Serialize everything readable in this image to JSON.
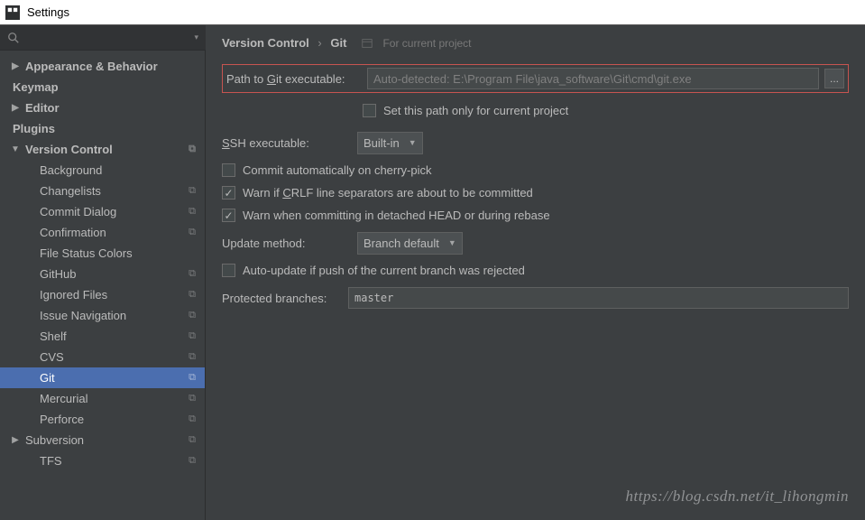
{
  "window": {
    "title": "Settings"
  },
  "search": {
    "placeholder": ""
  },
  "sidebar": {
    "items": [
      {
        "label": "Appearance & Behavior",
        "bold": true,
        "arrow": "▶"
      },
      {
        "label": "Keymap",
        "bold": true
      },
      {
        "label": "Editor",
        "bold": true,
        "arrow": "▶"
      },
      {
        "label": "Plugins",
        "bold": true
      },
      {
        "label": "Version Control",
        "bold": true,
        "arrow": "▼",
        "copy": true
      },
      {
        "label": "Background",
        "child": true
      },
      {
        "label": "Changelists",
        "child": true,
        "copy": true
      },
      {
        "label": "Commit Dialog",
        "child": true,
        "copy": true
      },
      {
        "label": "Confirmation",
        "child": true,
        "copy": true
      },
      {
        "label": "File Status Colors",
        "child": true
      },
      {
        "label": "GitHub",
        "child": true,
        "copy": true
      },
      {
        "label": "Ignored Files",
        "child": true,
        "copy": true
      },
      {
        "label": "Issue Navigation",
        "child": true,
        "copy": true
      },
      {
        "label": "Shelf",
        "child": true,
        "copy": true
      },
      {
        "label": "CVS",
        "child": true,
        "copy": true
      },
      {
        "label": "Git",
        "child": true,
        "copy": true,
        "selected": true
      },
      {
        "label": "Mercurial",
        "child": true,
        "copy": true
      },
      {
        "label": "Perforce",
        "child": true,
        "copy": true
      },
      {
        "label": "Subversion",
        "child": true,
        "arrow": "▶",
        "copy": true
      },
      {
        "label": "TFS",
        "child": true,
        "copy": true
      }
    ]
  },
  "breadcrumb": {
    "parent": "Version Control",
    "current": "Git",
    "scope": "For current project"
  },
  "form": {
    "path_label_pre": "Path to ",
    "path_label_ul": "G",
    "path_label_post": "it executable:",
    "path_value": "Auto-detected: E:\\Program File\\java_software\\Git\\cmd\\git.exe",
    "browse": "...",
    "set_path_only": "Set this path only for current project",
    "ssh_label_ul": "S",
    "ssh_label_post": "SH executable:",
    "ssh_value": "Built-in",
    "commit_auto": "Commit automatically on cherry-pick",
    "warn_crlf_pre": "Warn if ",
    "warn_crlf_ul": "C",
    "warn_crlf_post": "RLF line separators are about to be committed",
    "warn_detached": "Warn when committing in detached HEAD or during rebase",
    "update_label": "Update method:",
    "update_value": "Branch default",
    "auto_update": "Auto-update if push of the current branch was rejected",
    "protected_label": "Protected branches:",
    "protected_value": "master"
  },
  "watermark": "https://blog.csdn.net/it_lihongmin"
}
